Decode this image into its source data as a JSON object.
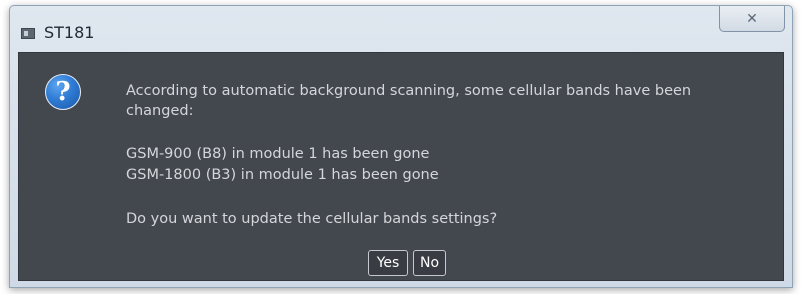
{
  "window": {
    "title": "ST181",
    "close_glyph": "✕"
  },
  "dialog": {
    "icon": "question-icon",
    "message_line1": "According to automatic background scanning, some cellular bands have been",
    "message_line2": "changed:",
    "change_1": "GSM-900 (B8) in module 1 has been gone",
    "change_2": "GSM-1800 (B3) in module 1 has been gone",
    "prompt": "Do you want to update the cellular bands settings?",
    "yes_label": "Yes",
    "no_label": "No"
  },
  "colors": {
    "content_bg": "#43474e",
    "text": "#d4d6da",
    "icon_blue": "#2f7bd4"
  }
}
